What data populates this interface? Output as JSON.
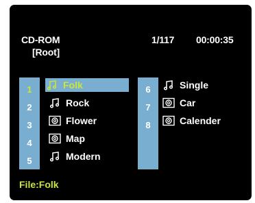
{
  "header": {
    "source": "CD-ROM",
    "folder": "[Root]",
    "track_count": "1/117",
    "time": "00:00:35"
  },
  "list": [
    {
      "num": "1",
      "label": "Folk",
      "icon": "music-note-icon",
      "selected": true
    },
    {
      "num": "2",
      "label": "Rock",
      "icon": "music-note-icon"
    },
    {
      "num": "3",
      "label": "Flower",
      "icon": "camera-icon"
    },
    {
      "num": "4",
      "label": "Map",
      "icon": "camera-icon"
    },
    {
      "num": "5",
      "label": "Modern",
      "icon": "music-note-icon"
    },
    {
      "num": "6",
      "label": "Single",
      "icon": "music-note-icon"
    },
    {
      "num": "7",
      "label": "Car",
      "icon": "camera-icon"
    },
    {
      "num": "8",
      "label": "Calender",
      "icon": "camera-icon"
    }
  ],
  "status": "File:Folk",
  "colors": {
    "background": "#000000",
    "highlight": "#7aaed0",
    "selected_text": "#c8e63a"
  }
}
